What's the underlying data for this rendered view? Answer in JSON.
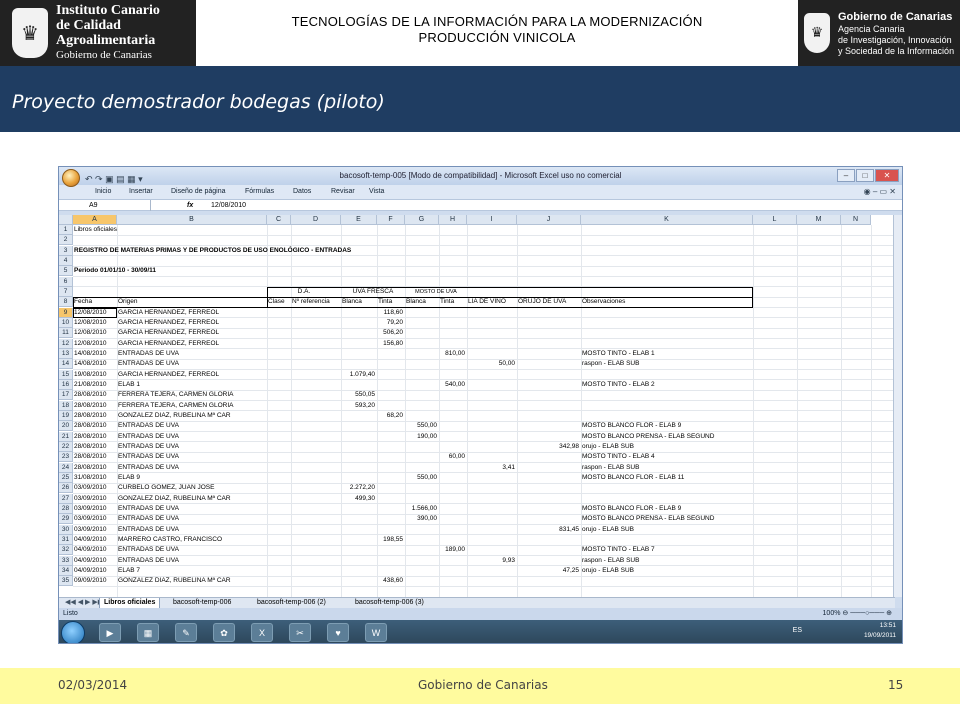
{
  "header": {
    "logo_left": {
      "line1": "Instituto Canario",
      "line2": "de Calidad",
      "line3": "Agroalimentaria",
      "line4": "Gobierno de Canarias"
    },
    "title_line1": "TECNOLOGÍAS DE LA INFORMACIÓN PARA LA MODERNIZACIÓN",
    "title_line2": "PRODUCCIÓN VINICOLA",
    "logo_right": {
      "line1": "Gobierno de Canarias",
      "line2": "Agencia Canaria",
      "line3": "de Investigación, Innovación",
      "line4": "y Sociedad de la Información"
    }
  },
  "band": {
    "title": "Proyecto demostrador  bodegas (piloto)"
  },
  "excel": {
    "window_title": "bacosoft-temp-005 [Modo de compatibilidad] - Microsoft Excel uso no comercial",
    "ribbon_tabs": [
      "Inicio",
      "Insertar",
      "Diseño de página",
      "Fórmulas",
      "Datos",
      "Revisar",
      "Vista"
    ],
    "name_box": "A9",
    "fx": "fx",
    "formula": "12/08/2010",
    "columns": [
      "A",
      "B",
      "C",
      "D",
      "E",
      "F",
      "G",
      "H",
      "I",
      "J",
      "K",
      "L",
      "M",
      "N"
    ],
    "row1": "Libros oficiales",
    "row3": "REGISTRO DE MATERIAS PRIMAS Y DE PRODUCTOS DE USO ENOLÓGICO - ENTRADAS",
    "row5": "Periodo 01/01/10 - 30/09/11",
    "group_headers": {
      "da": "D.A.",
      "uva": "UVA FRESCA",
      "mosto": "MOSTO DE UVA"
    },
    "headers": [
      "Fecha",
      "Origen",
      "Clase",
      "Nº referencia",
      "Blanca",
      "Tinta",
      "Blanca",
      "Tinta",
      "LIA DE VINO",
      "ORUJO DE UVA",
      "Observaciones"
    ],
    "rows": [
      {
        "n": "9",
        "fecha": "12/08/2010",
        "origen": "GARCIA HERNANDEZ, FERREOL",
        "e": "",
        "f": "118,60",
        "g": "",
        "h": "",
        "i": "",
        "j": "",
        "k": ""
      },
      {
        "n": "10",
        "fecha": "12/08/2010",
        "origen": "GARCIA HERNANDEZ, FERREOL",
        "e": "",
        "f": "79,20",
        "g": "",
        "h": "",
        "i": "",
        "j": "",
        "k": ""
      },
      {
        "n": "11",
        "fecha": "12/08/2010",
        "origen": "GARCIA HERNANDEZ, FERREOL",
        "e": "",
        "f": "506,20",
        "g": "",
        "h": "",
        "i": "",
        "j": "",
        "k": ""
      },
      {
        "n": "12",
        "fecha": "12/08/2010",
        "origen": "GARCIA HERNANDEZ, FERREOL",
        "e": "",
        "f": "156,80",
        "g": "",
        "h": "",
        "i": "",
        "j": "",
        "k": ""
      },
      {
        "n": "13",
        "fecha": "14/08/2010",
        "origen": "ENTRADAS DE UVA",
        "e": "",
        "f": "",
        "g": "",
        "h": "810,00",
        "i": "",
        "j": "",
        "k": "MOSTO  TINTO - ELAB 1"
      },
      {
        "n": "14",
        "fecha": "14/08/2010",
        "origen": "ENTRADAS DE UVA",
        "e": "",
        "f": "",
        "g": "",
        "h": "",
        "i": "50,00",
        "j": "",
        "k": "raspon - ELAB SUB"
      },
      {
        "n": "15",
        "fecha": "19/08/2010",
        "origen": "GARCIA HERNANDEZ, FERREOL",
        "e": "1.079,40",
        "f": "",
        "g": "",
        "h": "",
        "i": "",
        "j": "",
        "k": ""
      },
      {
        "n": "16",
        "fecha": "21/08/2010",
        "origen": "ELAB 1",
        "e": "",
        "f": "",
        "g": "",
        "h": "540,00",
        "i": "",
        "j": "",
        "k": "MOSTO  TINTO - ELAB 2"
      },
      {
        "n": "17",
        "fecha": "28/08/2010",
        "origen": "FERRERA TEJERA, CARMEN GLORIA",
        "e": "550,05",
        "f": "",
        "g": "",
        "h": "",
        "i": "",
        "j": "",
        "k": ""
      },
      {
        "n": "18",
        "fecha": "28/08/2010",
        "origen": "FERRERA TEJERA, CARMEN GLORIA",
        "e": "593,20",
        "f": "",
        "g": "",
        "h": "",
        "i": "",
        "j": "",
        "k": ""
      },
      {
        "n": "19",
        "fecha": "28/08/2010",
        "origen": "GONZALEZ DIAZ, RUBELINA Mª CAR",
        "e": "",
        "f": "68,20",
        "g": "",
        "h": "",
        "i": "",
        "j": "",
        "k": ""
      },
      {
        "n": "20",
        "fecha": "28/08/2010",
        "origen": "ENTRADAS DE UVA",
        "e": "",
        "f": "",
        "g": "550,00",
        "h": "",
        "i": "",
        "j": "",
        "k": "MOSTO BLANCO FLOR - ELAB 9"
      },
      {
        "n": "21",
        "fecha": "28/08/2010",
        "origen": "ENTRADAS DE UVA",
        "e": "",
        "f": "",
        "g": "190,00",
        "h": "",
        "i": "",
        "j": "",
        "k": "MOSTO BLANCO PRENSA - ELAB SEGUND"
      },
      {
        "n": "22",
        "fecha": "28/08/2010",
        "origen": "ENTRADAS DE UVA",
        "e": "",
        "f": "",
        "g": "",
        "h": "",
        "i": "",
        "j": "342,98",
        "k": "orujo - ELAB SUB"
      },
      {
        "n": "23",
        "fecha": "28/08/2010",
        "origen": "ENTRADAS DE UVA",
        "e": "",
        "f": "",
        "g": "",
        "h": "60,00",
        "i": "",
        "j": "",
        "k": "MOSTO  TINTO - ELAB 4"
      },
      {
        "n": "24",
        "fecha": "28/08/2010",
        "origen": "ENTRADAS DE UVA",
        "e": "",
        "f": "",
        "g": "",
        "h": "",
        "i": "3,41",
        "j": "",
        "k": "raspon - ELAB SUB"
      },
      {
        "n": "25",
        "fecha": "31/08/2010",
        "origen": "ELAB 9",
        "e": "",
        "f": "",
        "g": "550,00",
        "h": "",
        "i": "",
        "j": "",
        "k": "MOSTO BLANCO FLOR - ELAB 11"
      },
      {
        "n": "26",
        "fecha": "03/09/2010",
        "origen": "CURBELO GOMEZ, JUAN JOSE",
        "e": "2.272,20",
        "f": "",
        "g": "",
        "h": "",
        "i": "",
        "j": "",
        "k": ""
      },
      {
        "n": "27",
        "fecha": "03/09/2010",
        "origen": "GONZALEZ DIAZ, RUBELINA Mª CAR",
        "e": "499,30",
        "f": "",
        "g": "",
        "h": "",
        "i": "",
        "j": "",
        "k": ""
      },
      {
        "n": "28",
        "fecha": "03/09/2010",
        "origen": "ENTRADAS DE UVA",
        "e": "",
        "f": "",
        "g": "1.566,00",
        "h": "",
        "i": "",
        "j": "",
        "k": "MOSTO BLANCO FLOR - ELAB 9"
      },
      {
        "n": "29",
        "fecha": "03/09/2010",
        "origen": "ENTRADAS DE UVA",
        "e": "",
        "f": "",
        "g": "390,00",
        "h": "",
        "i": "",
        "j": "",
        "k": "MOSTO BLANCO PRENSA - ELAB SEGUND"
      },
      {
        "n": "30",
        "fecha": "03/09/2010",
        "origen": "ENTRADAS DE UVA",
        "e": "",
        "f": "",
        "g": "",
        "h": "",
        "i": "",
        "j": "831,45",
        "k": "orujo - ELAB SUB"
      },
      {
        "n": "31",
        "fecha": "04/09/2010",
        "origen": "MARRERO CASTRO, FRANCISCO",
        "e": "",
        "f": "198,55",
        "g": "",
        "h": "",
        "i": "",
        "j": "",
        "k": ""
      },
      {
        "n": "32",
        "fecha": "04/09/2010",
        "origen": "ENTRADAS DE UVA",
        "e": "",
        "f": "",
        "g": "",
        "h": "189,00",
        "i": "",
        "j": "",
        "k": "MOSTO  TINTO - ELAB 7"
      },
      {
        "n": "33",
        "fecha": "04/09/2010",
        "origen": "ENTRADAS DE UVA",
        "e": "",
        "f": "",
        "g": "",
        "h": "",
        "i": "9,93",
        "j": "",
        "k": "raspon - ELAB SUB"
      },
      {
        "n": "34",
        "fecha": "04/09/2010",
        "origen": "ELAB 7",
        "e": "",
        "f": "",
        "g": "",
        "h": "",
        "i": "",
        "j": "47,25",
        "k": "orujo - ELAB SUB"
      },
      {
        "n": "35",
        "fecha": "09/09/2010",
        "origen": "GONZALEZ DIAZ, RUBELINA Mª CAR",
        "e": "",
        "f": "438,60",
        "g": "",
        "h": "",
        "i": "",
        "j": "",
        "k": ""
      }
    ],
    "sheet_tabs": [
      "Libros oficiales",
      "bacosoft-temp-006",
      "bacosoft-temp-006 (2)",
      "bacosoft-temp-006 (3)"
    ],
    "status": "Listo",
    "zoom": "100%",
    "tray": {
      "lang": "ES",
      "time": "13:51",
      "date": "19/09/2011"
    }
  },
  "footer": {
    "date": "02/03/2014",
    "center": "Gobierno de Canarias",
    "page": "15"
  }
}
